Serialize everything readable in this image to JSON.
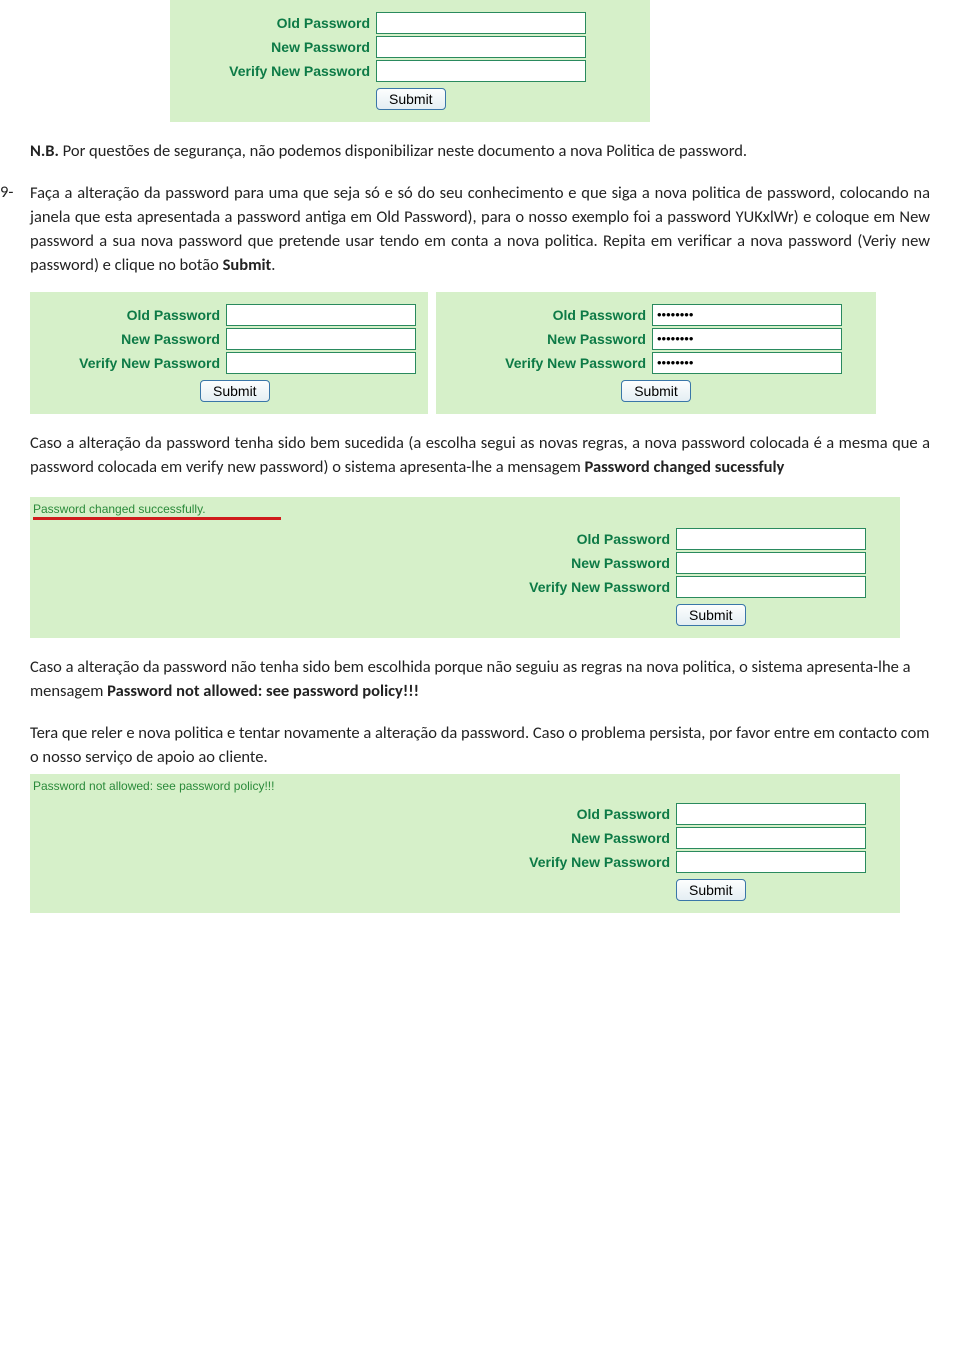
{
  "form": {
    "old_label": "Old Password",
    "new_label": "New Password",
    "verify_label": "Verify New Password",
    "submit_label": "Submit",
    "old_value_empty": "",
    "new_value_empty": "",
    "verify_value_empty": "",
    "old_value_filled": "••••••••",
    "new_value_filled": "••••••••",
    "verify_value_filled": "••••••••"
  },
  "text": {
    "nb_prefix": "N.B.",
    "nb_body": " Por questões de segurança, não podemos disponibilizar neste documento a nova Politica de password.",
    "step9_num": "9-",
    "step9_body_a": "Faça a alteração da password para uma que seja só e só do seu conhecimento e que siga a nova politica de password, colocando na janela que esta apresentada a password antiga em Old Password), para o nosso exemplo foi a password YUKxlWr) e coloque em New password a sua nova password que pretende usar tendo em conta a nova politica. Repita em verificar a nova password (Veriy new password) e clique no botão ",
    "step9_submit_word": "Submit",
    "step9_body_b": ".",
    "success_para_a": "Caso a alteração da password tenha sido bem sucedida (a escolha segui as novas regras, a nova password colocada é a mesma que a password colocada em verify new password) o sistema apresenta-lhe a mensagem ",
    "success_bold": "Password changed sucessfuly",
    "fail_para_a": "Caso a alteração da password não tenha sido bem escolhida porque não seguiu as regras na nova politica, o sistema apresenta-lhe a mensagem ",
    "fail_bold": "Password not allowed: see password policy!!!",
    "retry_para": "Tera que reler e nova politica e tentar novamente a alteração da password. Caso o problema persista, por favor entre em contacto com o nosso serviço de apoio ao cliente.",
    "msg_success": "Password changed successfully.",
    "msg_fail": "Password not allowed: see password policy!!!"
  }
}
